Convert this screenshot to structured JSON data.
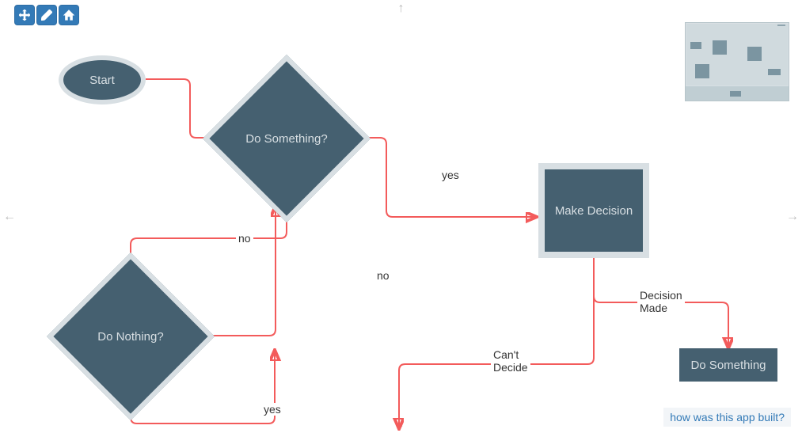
{
  "toolbar": {
    "move_tool": "Move",
    "edit_tool": "Edit",
    "home_tool": "Home"
  },
  "nodes": {
    "start": {
      "label": "Start"
    },
    "do_something_q": {
      "label": "Do Something?"
    },
    "do_nothing_q": {
      "label": "Do Nothing?"
    },
    "make_decision": {
      "label": "Make Decision"
    },
    "do_something": {
      "label": "Do Something"
    }
  },
  "edges": {
    "ds_yes": "yes",
    "ds_no": "no",
    "dn_no": "no",
    "dn_yes": "yes",
    "md_made": "Decision\nMade",
    "md_cant": "Can't\nDecide"
  },
  "footer": {
    "link": "how was this app built?"
  },
  "colors": {
    "node_fill": "#456070",
    "node_border": "#d8dfe3",
    "edge": "#f35b5b",
    "toolbar": "#337ab7"
  }
}
